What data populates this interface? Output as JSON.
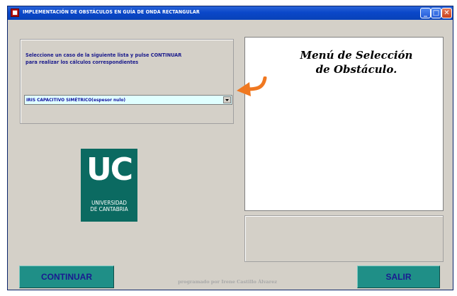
{
  "window": {
    "title": "IMPLEMENTACIÓN DE OBSTÁCULOS EN GUÍA DE ONDA RECTANGULAR",
    "controls": {
      "minimize": "_",
      "maximize": "□",
      "close": "✕"
    }
  },
  "selection_panel": {
    "instruction_line1": "Seleccione un caso de la siguiente lista y pulse CONTINUAR",
    "instruction_line2": "para realizar los cálculos correspondientes",
    "dropdown_value": "IRIS CAPACITIVO SIMÉTRICO(espesor nulo)"
  },
  "logo": {
    "monogram": "UC",
    "line1": "UNIVERSIDAD",
    "line2": "DE CANTABRIA"
  },
  "annotation": {
    "line1": "Menú de Selección",
    "line2": "de Obstáculo."
  },
  "buttons": {
    "continuar": "CONTINUAR",
    "salir": "SALIR"
  },
  "footer": {
    "credit": "programado por Irene Castillo Álvarez"
  },
  "colors": {
    "titlebar": "#0a47c9",
    "window_bg": "#d4d0c8",
    "dropdown_bg": "#e0ffff",
    "logo_bg": "#0b6a61",
    "button_bg": "#1f8f87",
    "arrow": "#f07820"
  }
}
